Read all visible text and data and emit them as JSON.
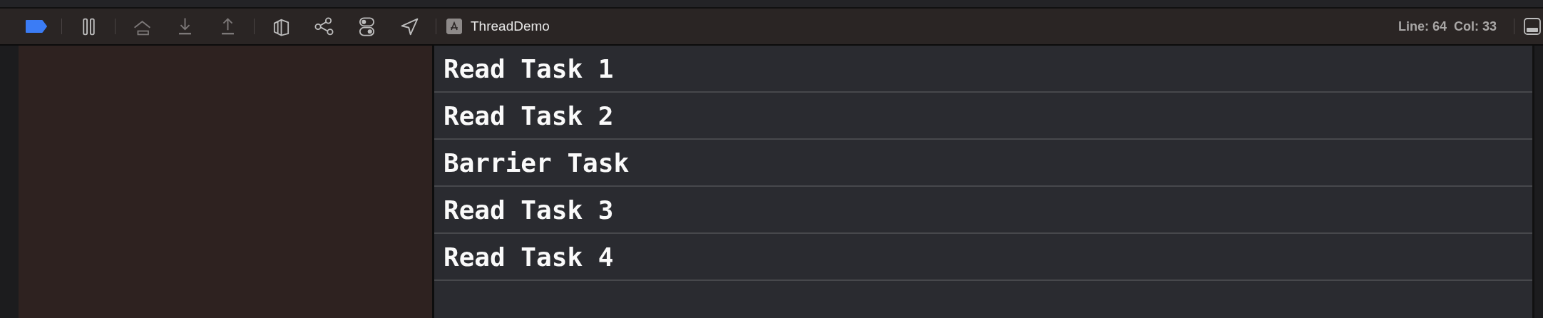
{
  "debug_bar": {
    "breakpoints_active": true,
    "buttons": [
      {
        "kind": "pause",
        "disabled": false
      },
      {
        "kind": "step-over",
        "disabled": true
      },
      {
        "kind": "step-into",
        "disabled": true
      },
      {
        "kind": "step-out",
        "disabled": true
      },
      {
        "kind": "view-hierarchy",
        "disabled": false
      },
      {
        "kind": "memory-graph",
        "disabled": false
      },
      {
        "kind": "environment",
        "disabled": false
      },
      {
        "kind": "location",
        "disabled": false
      }
    ],
    "process": "ThreadDemo",
    "position": "Line: 64  Col: 33"
  },
  "console": {
    "lines": [
      "Read Task 1",
      "Read Task 2",
      "Barrier Task",
      "Read Task 3",
      "Read Task 4"
    ]
  }
}
